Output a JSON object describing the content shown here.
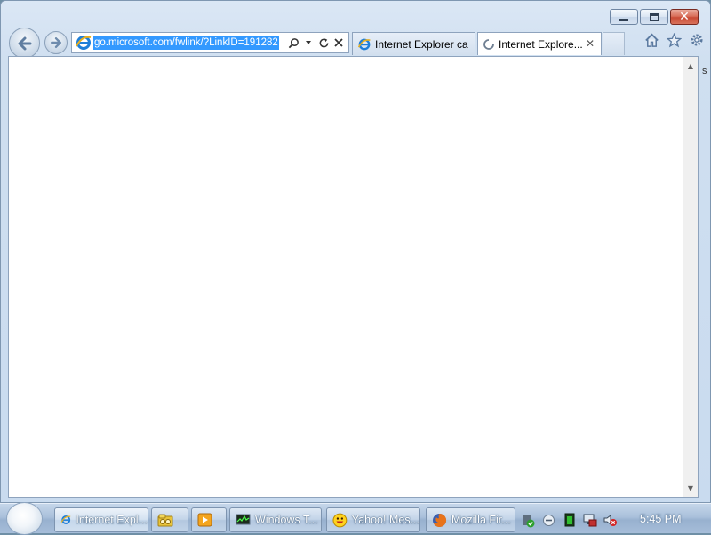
{
  "window": {
    "caption_buttons": [
      "minimize",
      "maximize",
      "close"
    ]
  },
  "navigation": {
    "back_icon": "back-arrow-icon",
    "forward_icon": "forward-arrow-icon"
  },
  "address_bar": {
    "url": "go.microsoft.com/fwlink/?LinkID=191282",
    "url_selected": true,
    "tools": [
      "search-icon",
      "dropdown-icon",
      "refresh-icon",
      "stop-icon"
    ]
  },
  "tabs": [
    {
      "label": "Internet Explorer ca",
      "icon": "ie-icon",
      "active": false
    },
    {
      "label": "Internet Explore...",
      "icon": "loading-icon",
      "active": true,
      "close": "✕"
    }
  ],
  "toolbar_right": [
    "home-icon",
    "favorites-star-icon",
    "tools-gear-icon"
  ],
  "content": {
    "background": "#ffffff",
    "behind_window_glyph": "s"
  },
  "taskbar": {
    "items": [
      {
        "label": "Internet Expl...",
        "icon": "ie-icon",
        "active": true
      },
      {
        "label": "",
        "icon": "windows-explorer-icon",
        "active": false
      },
      {
        "label": "",
        "icon": "media-player-icon",
        "active": false
      },
      {
        "label": "Windows T...",
        "icon": "task-manager-icon",
        "active": false
      },
      {
        "label": "Yahoo! Mes...",
        "icon": "yahoo-messenger-icon",
        "active": false
      },
      {
        "label": "Mozilla Fir...",
        "icon": "firefox-icon",
        "active": false
      }
    ],
    "tray_icons": [
      "security-check-icon",
      "network-icon",
      "battery-icon",
      "display-icon",
      "volume-muted-icon"
    ],
    "clock": "5:45 PM"
  },
  "colors": {
    "selection": "#3399ff",
    "chrome": "#cfdff0",
    "close_button": "#c94a35"
  }
}
